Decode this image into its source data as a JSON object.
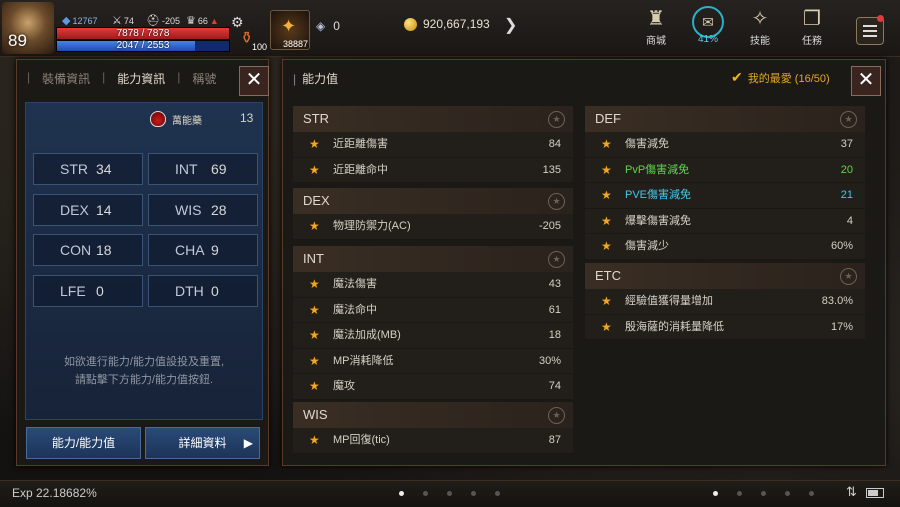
{
  "hud": {
    "level": "89",
    "hp_text": "7878 / 7878",
    "hp_fraction": 1.0,
    "mp_text": "2047 / 2553",
    "mp_fraction": 0.8,
    "ministats": [
      "12767",
      "74",
      "-205",
      "66"
    ],
    "quickslot_counts": [
      "100",
      "38887"
    ],
    "crystal_count": "0",
    "gold": "920,667,193",
    "icons": [
      {
        "label": "商城",
        "name": "shop"
      },
      {
        "label": "41%",
        "name": "weight"
      },
      {
        "label": "技能",
        "name": "skills"
      },
      {
        "label": "任務",
        "name": "quests"
      }
    ]
  },
  "left_panel": {
    "tabs": [
      "裝備資訊",
      "能力資訊",
      "稱號"
    ],
    "elixir_label": "萬能藥",
    "elixir_count": "13",
    "stats": [
      {
        "name": "STR",
        "value": "34"
      },
      {
        "name": "INT",
        "value": "69"
      },
      {
        "name": "DEX",
        "value": "14"
      },
      {
        "name": "WIS",
        "value": "28"
      },
      {
        "name": "CON",
        "value": "18"
      },
      {
        "name": "CHA",
        "value": "9"
      },
      {
        "name": "LFE",
        "value": "0"
      },
      {
        "name": "DTH",
        "value": "0"
      }
    ],
    "hint_line1": "如欲進行能力/能力值設投及重置,",
    "hint_line2": "請點擊下方能力/能力值按鈕.",
    "btn_ability": "能力/能力值",
    "btn_detail": "詳細資料"
  },
  "right_panel": {
    "title": "能力值",
    "favorites": "我的最愛 (16/50)",
    "sections": {
      "str": {
        "title": "STR",
        "rows": [
          {
            "label": "近距離傷害",
            "value": "84"
          },
          {
            "label": "近距離命中",
            "value": "135"
          }
        ]
      },
      "dex": {
        "title": "DEX",
        "rows": [
          {
            "label": "物理防禦力(AC)",
            "value": "-205"
          }
        ]
      },
      "int": {
        "title": "INT",
        "rows": [
          {
            "label": "魔法傷害",
            "value": "43"
          },
          {
            "label": "魔法命中",
            "value": "61"
          },
          {
            "label": "魔法加成(MB)",
            "value": "18"
          },
          {
            "label": "MP消耗降低",
            "value": "30%"
          },
          {
            "label": "魔攻",
            "value": "74"
          }
        ]
      },
      "wis": {
        "title": "WIS",
        "rows": [
          {
            "label": "MP回復(tic)",
            "value": "87"
          }
        ]
      },
      "def": {
        "title": "DEF",
        "rows": [
          {
            "label": "傷害減免",
            "value": "37"
          },
          {
            "label": "PvP傷害減免",
            "value": "20"
          },
          {
            "label": "PVE傷害減免",
            "value": "21"
          },
          {
            "label": "爆擊傷害減免",
            "value": "4"
          },
          {
            "label": "傷害減少",
            "value": "60%"
          }
        ]
      },
      "etc": {
        "title": "ETC",
        "rows": [
          {
            "label": "經驗值獲得量增加",
            "value": "83.0%"
          },
          {
            "label": "殷海薩的消耗量降低",
            "value": "17%"
          }
        ]
      }
    }
  },
  "bottom": {
    "exp": "Exp 22.18682%"
  },
  "colors": {
    "pvp": "#5ad84a",
    "pve": "#4ac6e8",
    "star": "#f0a820",
    "accent": "#2a4a78"
  }
}
